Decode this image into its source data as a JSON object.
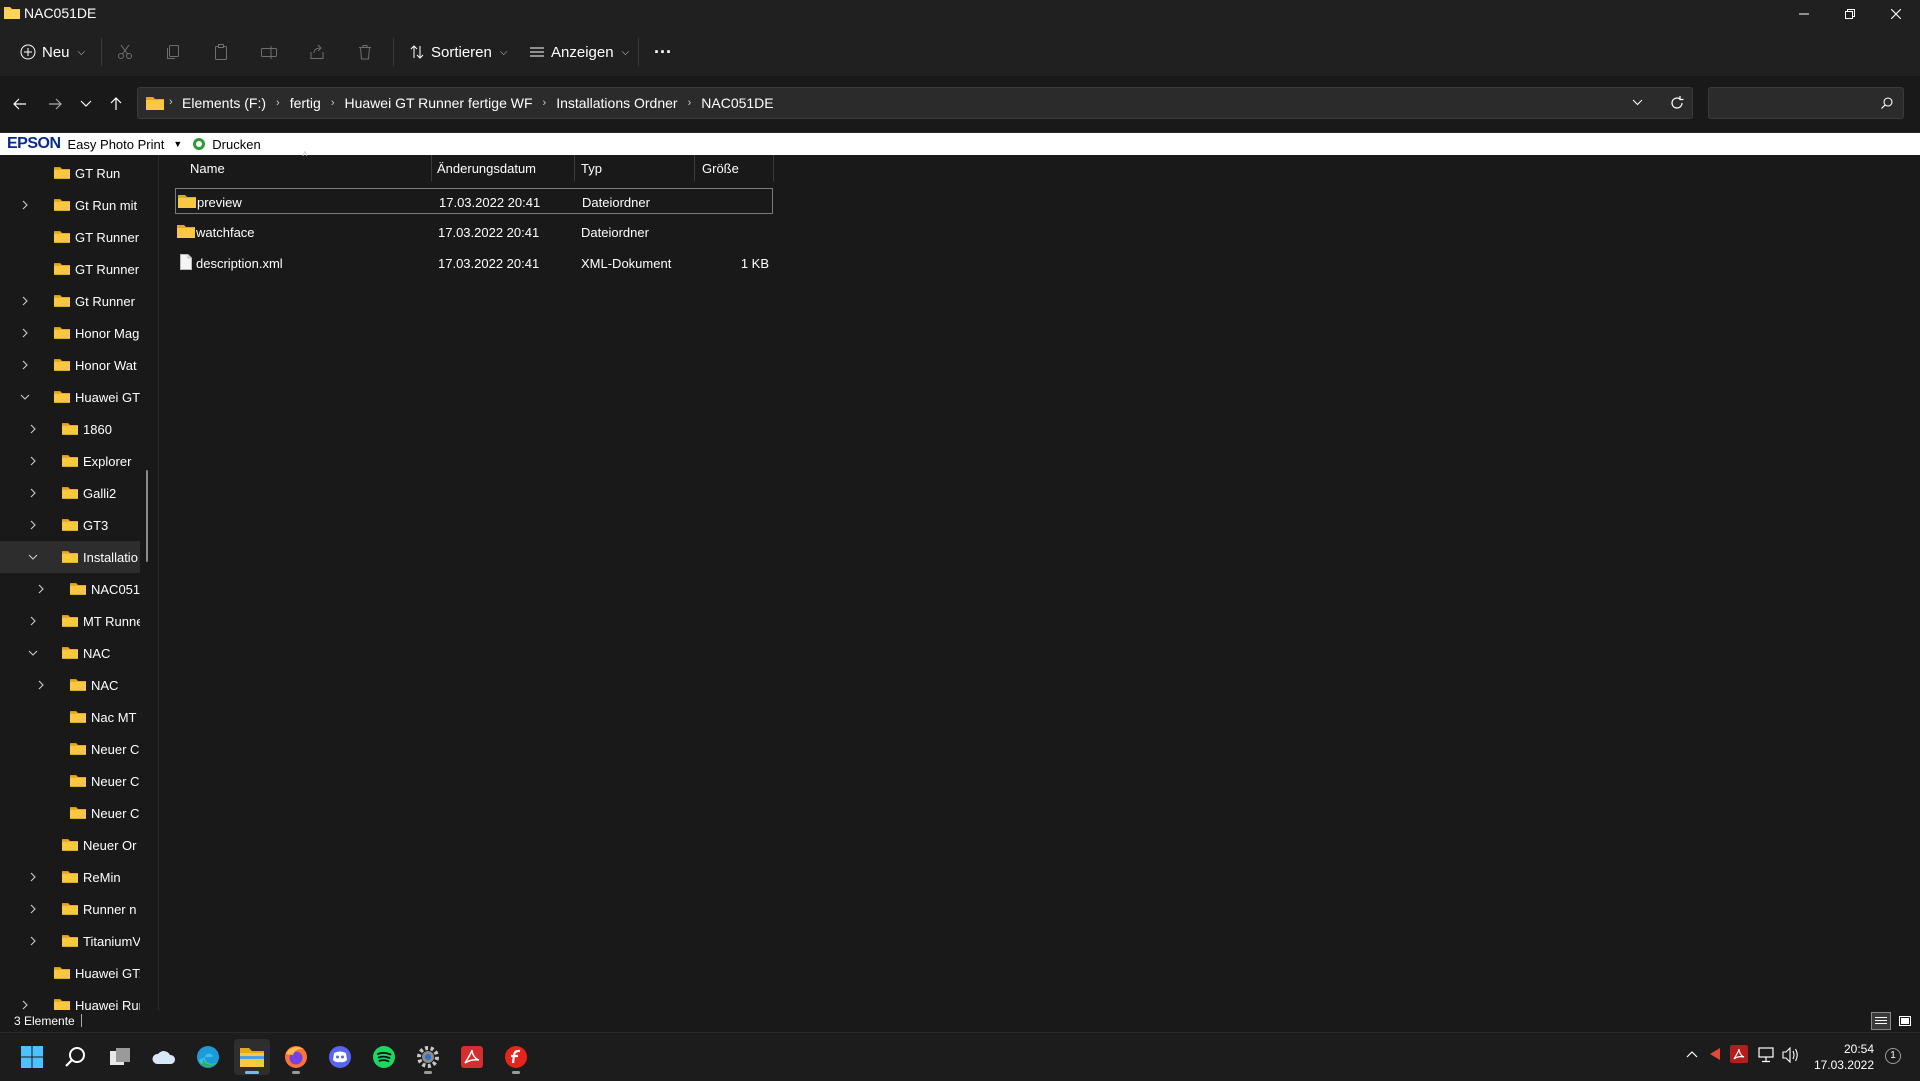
{
  "window": {
    "title": "NAC051DE"
  },
  "toolbar": {
    "new_label": "Neu",
    "sort_label": "Sortieren",
    "view_label": "Anzeigen",
    "more_label": "···"
  },
  "address": {
    "crumbs": [
      "Elements (F:)",
      "fertig",
      "Huawei GT Runner fertige WF",
      "Installations Ordner",
      "NAC051DE"
    ],
    "search_placeholder": ""
  },
  "epson": {
    "brand": "EPSON",
    "app": "Easy Photo Print",
    "print_label": "Drucken"
  },
  "sidebar": {
    "items": [
      {
        "label": "GT Run",
        "indent": 0,
        "chevron": "none"
      },
      {
        "label": "Gt Run mit",
        "indent": 0,
        "chevron": "right"
      },
      {
        "label": "GT Runner",
        "indent": 0,
        "chevron": "none"
      },
      {
        "label": "GT Runner",
        "indent": 0,
        "chevron": "none"
      },
      {
        "label": "Gt Runner ",
        "indent": 0,
        "chevron": "right"
      },
      {
        "label": "Honor Mag",
        "indent": 0,
        "chevron": "right"
      },
      {
        "label": "Honor Wat",
        "indent": 0,
        "chevron": "right"
      },
      {
        "label": "Huawei GT",
        "indent": 0,
        "chevron": "down"
      },
      {
        "label": "1860",
        "indent": 1,
        "chevron": "right"
      },
      {
        "label": "Explorer",
        "indent": 1,
        "chevron": "right"
      },
      {
        "label": "Galli2",
        "indent": 1,
        "chevron": "right"
      },
      {
        "label": "GT3",
        "indent": 1,
        "chevron": "right"
      },
      {
        "label": "Installatio",
        "indent": 1,
        "chevron": "down",
        "selected": true
      },
      {
        "label": "NAC051",
        "indent": 2,
        "chevron": "right"
      },
      {
        "label": "MT Runne",
        "indent": 1,
        "chevron": "right"
      },
      {
        "label": "NAC",
        "indent": 1,
        "chevron": "down"
      },
      {
        "label": "NAC",
        "indent": 2,
        "chevron": "right"
      },
      {
        "label": "Nac MT",
        "indent": 2,
        "chevron": "none"
      },
      {
        "label": "Neuer C",
        "indent": 2,
        "chevron": "none"
      },
      {
        "label": "Neuer C",
        "indent": 2,
        "chevron": "none"
      },
      {
        "label": "Neuer C",
        "indent": 2,
        "chevron": "none"
      },
      {
        "label": "Neuer Or",
        "indent": 1,
        "chevron": "none"
      },
      {
        "label": "ReMin",
        "indent": 1,
        "chevron": "right"
      },
      {
        "label": "Runner  n",
        "indent": 1,
        "chevron": "right"
      },
      {
        "label": "TitaniumV",
        "indent": 1,
        "chevron": "right"
      },
      {
        "label": "Huawei GT:",
        "indent": 0,
        "chevron": "none"
      },
      {
        "label": "Huawei Rur",
        "indent": 0,
        "chevron": "right"
      }
    ]
  },
  "filelist": {
    "columns": {
      "name": "Name",
      "date": "Änderungsdatum",
      "type": "Typ",
      "size": "Größe"
    },
    "rows": [
      {
        "name": "preview",
        "date": "17.03.2022 20:41",
        "type": "Dateiordner",
        "size": "",
        "icon": "folder-icon",
        "selected": true
      },
      {
        "name": "watchface",
        "date": "17.03.2022 20:41",
        "type": "Dateiordner",
        "size": "",
        "icon": "folder-icon"
      },
      {
        "name": "description.xml",
        "date": "17.03.2022 20:41",
        "type": "XML-Dokument",
        "size": "1 KB",
        "icon": "file-icon"
      }
    ]
  },
  "status": {
    "count": "3 Elemente"
  },
  "taskbar": {
    "apps": [
      "windows-start-icon",
      "search-icon",
      "task-view-icon",
      "onedrive-icon",
      "edge-icon",
      "file-explorer-icon",
      "firefox-icon",
      "discord-icon",
      "spotify-icon",
      "settings-icon",
      "acrobat-icon",
      "flash-icon"
    ],
    "time": "20:54",
    "date": "17.03.2022",
    "notification_count": "1"
  },
  "colors": {
    "background": "#191919",
    "toolbar": "#202020",
    "folder": "#f8c843",
    "accent": "#76b9ed"
  }
}
